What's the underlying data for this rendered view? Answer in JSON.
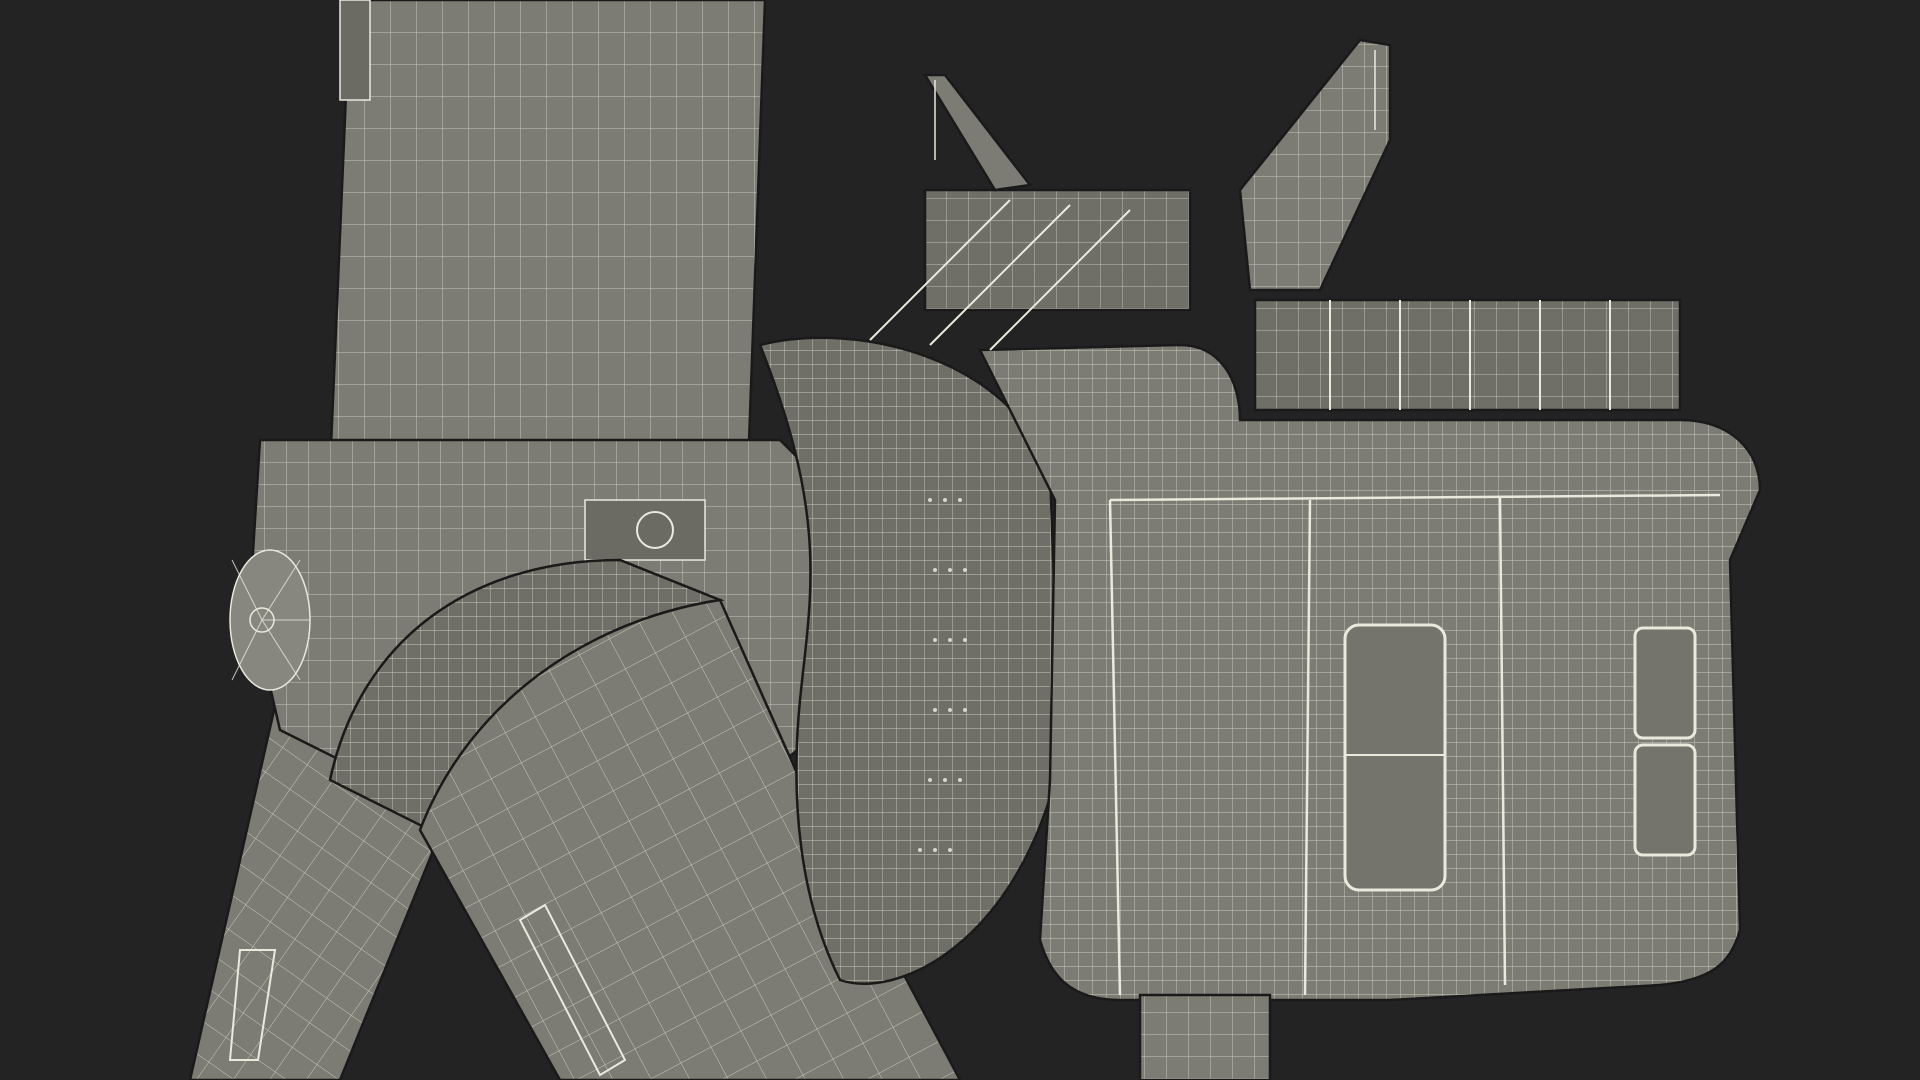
{
  "scene": {
    "subject": "wind-turbine-nacelle-wireframe",
    "colors": {
      "background": "#232323",
      "surface": "#7c7c74",
      "surface_dark": "#6f6f68",
      "surface_light": "#87877f",
      "wire": "#e9e9dc",
      "wire_soft": "#cfcfc2",
      "edge": "#1a1a1a"
    }
  }
}
